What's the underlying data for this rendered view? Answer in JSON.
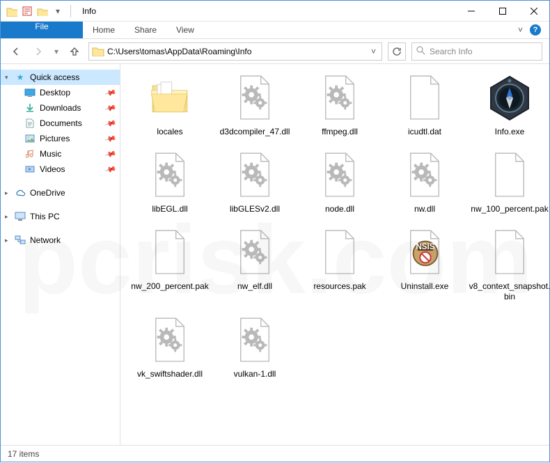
{
  "window": {
    "title": "Info",
    "min": "Minimize",
    "max": "Maximize",
    "close": "Close"
  },
  "ribbon": {
    "file": "File",
    "tabs": [
      "Home",
      "Share",
      "View"
    ]
  },
  "nav": {
    "address": "C:\\Users\\tomas\\AppData\\Roaming\\Info",
    "search_placeholder": "Search Info"
  },
  "sidebar": {
    "quick_access": "Quick access",
    "pinned": [
      {
        "label": "Desktop",
        "icon": "desktop"
      },
      {
        "label": "Downloads",
        "icon": "downloads"
      },
      {
        "label": "Documents",
        "icon": "documents"
      },
      {
        "label": "Pictures",
        "icon": "pictures"
      },
      {
        "label": "Music",
        "icon": "music"
      },
      {
        "label": "Videos",
        "icon": "videos"
      }
    ],
    "onedrive": "OneDrive",
    "thispc": "This PC",
    "network": "Network"
  },
  "files": [
    {
      "name": "locales",
      "type": "folder"
    },
    {
      "name": "d3dcompiler_47.dll",
      "type": "dll"
    },
    {
      "name": "ffmpeg.dll",
      "type": "dll"
    },
    {
      "name": "icudtl.dat",
      "type": "file"
    },
    {
      "name": "Info.exe",
      "type": "compass"
    },
    {
      "name": "libEGL.dll",
      "type": "dll"
    },
    {
      "name": "libGLESv2.dll",
      "type": "dll"
    },
    {
      "name": "node.dll",
      "type": "dll"
    },
    {
      "name": "nw.dll",
      "type": "dll"
    },
    {
      "name": "nw_100_percent.pak",
      "type": "file"
    },
    {
      "name": "nw_200_percent.pak",
      "type": "file"
    },
    {
      "name": "nw_elf.dll",
      "type": "dll"
    },
    {
      "name": "resources.pak",
      "type": "file"
    },
    {
      "name": "Uninstall.exe",
      "type": "uninstall"
    },
    {
      "name": "v8_context_snapshot.bin",
      "type": "file"
    },
    {
      "name": "vk_swiftshader.dll",
      "type": "dll"
    },
    {
      "name": "vulkan-1.dll",
      "type": "dll"
    }
  ],
  "status": {
    "count": "17 items"
  },
  "icon_labels": {
    "desktop": "Desktop",
    "downloads": "Downloads",
    "documents": "Documents",
    "pictures": "Pictures",
    "music": "Music",
    "videos": "Videos"
  }
}
